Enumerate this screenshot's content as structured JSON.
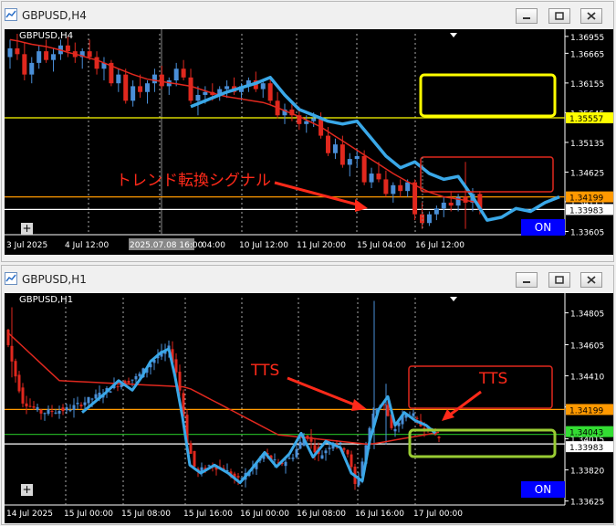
{
  "windows": [
    {
      "title": "GBPUSD,H4",
      "chart_label": "GBPUSD,H4",
      "on_label": "ON",
      "plus_label": "+",
      "annotation": "トレンド転換シグナル"
    },
    {
      "title": "GBPUSD,H1",
      "chart_label": "GBPUSD,H1",
      "on_label": "ON",
      "plus_label": "+",
      "annotation_left": "TTS",
      "annotation_right": "TTS"
    }
  ],
  "colors": {
    "bull": "#4a8fd8",
    "bear": "#e0281e",
    "ma": "#e0281e",
    "overlay": "#3aa8e8",
    "yellow": "#ffff00",
    "orange": "#ff9900",
    "green": "#22aa22",
    "white": "#ffffff",
    "lime_box": "#99cc33"
  },
  "chart_data": [
    {
      "type": "candlestick",
      "symbol": "GBPUSD",
      "timeframe": "H4",
      "x_tick_labels": [
        "3 Jul 2025",
        "4 Jul 12:00",
        "2025.07.08 16:00",
        "04:00",
        "10 Jul 12:00",
        "11 Jul 20:00",
        "15 Jul 04:00",
        "16 Jul 12:00"
      ],
      "y_tick_labels": [
        "1.36955",
        "1.36665",
        "1.36155",
        "1.35645",
        "1.35135",
        "1.34625",
        "1.34115",
        "1.33605"
      ],
      "ylim": [
        1.3355,
        1.37
      ],
      "price_labels": [
        {
          "value": "1.35557",
          "color": "yellow"
        },
        {
          "value": "1.34199",
          "color": "orange"
        },
        {
          "value": "1.33983",
          "color": "white"
        }
      ],
      "horizontal_lines": [
        {
          "value": 1.35557,
          "color": "yellow"
        },
        {
          "value": 1.34199,
          "color": "orange"
        },
        {
          "value": 1.33983,
          "color": "white"
        }
      ],
      "candles": [
        [
          1.366,
          1.369,
          1.364,
          1.3675
        ],
        [
          1.3675,
          1.37,
          1.3655,
          1.3665
        ],
        [
          1.3665,
          1.3685,
          1.362,
          1.363
        ],
        [
          1.363,
          1.366,
          1.3615,
          1.365
        ],
        [
          1.365,
          1.368,
          1.364,
          1.367
        ],
        [
          1.367,
          1.369,
          1.365,
          1.3655
        ],
        [
          1.3655,
          1.3675,
          1.3635,
          1.3665
        ],
        [
          1.3665,
          1.369,
          1.3655,
          1.368
        ],
        [
          1.368,
          1.3695,
          1.366,
          1.367
        ],
        [
          1.367,
          1.3685,
          1.365,
          1.366
        ],
        [
          1.366,
          1.3675,
          1.364,
          1.367
        ],
        [
          1.367,
          1.369,
          1.3655,
          1.366
        ],
        [
          1.366,
          1.367,
          1.363,
          1.364
        ],
        [
          1.364,
          1.366,
          1.362,
          1.365
        ],
        [
          1.365,
          1.3655,
          1.361,
          1.3615
        ],
        [
          1.3615,
          1.364,
          1.36,
          1.363
        ],
        [
          1.363,
          1.364,
          1.358,
          1.3585
        ],
        [
          1.3585,
          1.362,
          1.3575,
          1.361
        ],
        [
          1.361,
          1.363,
          1.359,
          1.36
        ],
        [
          1.36,
          1.362,
          1.358,
          1.3615
        ],
        [
          1.3615,
          1.364,
          1.36,
          1.363
        ],
        [
          1.363,
          1.3645,
          1.3605,
          1.361
        ],
        [
          1.361,
          1.3625,
          1.3595,
          1.362
        ],
        [
          1.362,
          1.365,
          1.361,
          1.364
        ],
        [
          1.364,
          1.3655,
          1.362,
          1.3625
        ],
        [
          1.3625,
          1.364,
          1.358,
          1.3585
        ],
        [
          1.3585,
          1.361,
          1.356,
          1.3595
        ],
        [
          1.3595,
          1.361,
          1.358,
          1.36
        ],
        [
          1.36,
          1.3615,
          1.3585,
          1.3595
        ],
        [
          1.3595,
          1.361,
          1.3585,
          1.3605
        ],
        [
          1.3605,
          1.362,
          1.359,
          1.361
        ],
        [
          1.361,
          1.3625,
          1.3595,
          1.36
        ],
        [
          1.36,
          1.3615,
          1.3585,
          1.361
        ],
        [
          1.361,
          1.3625,
          1.36,
          1.362
        ],
        [
          1.362,
          1.3635,
          1.36,
          1.3605
        ],
        [
          1.3605,
          1.362,
          1.359,
          1.3615
        ],
        [
          1.3615,
          1.3625,
          1.358,
          1.3585
        ],
        [
          1.3585,
          1.36,
          1.3555,
          1.356
        ],
        [
          1.356,
          1.358,
          1.3545,
          1.357
        ],
        [
          1.357,
          1.3585,
          1.355,
          1.356
        ],
        [
          1.356,
          1.3575,
          1.3535,
          1.3545
        ],
        [
          1.3545,
          1.356,
          1.353,
          1.355
        ],
        [
          1.355,
          1.3565,
          1.354,
          1.3555
        ],
        [
          1.3555,
          1.3565,
          1.352,
          1.3525
        ],
        [
          1.3525,
          1.354,
          1.349,
          1.3495
        ],
        [
          1.3495,
          1.352,
          1.3485,
          1.351
        ],
        [
          1.351,
          1.3525,
          1.347,
          1.3475
        ],
        [
          1.3475,
          1.3495,
          1.3455,
          1.3485
        ],
        [
          1.3485,
          1.35,
          1.347,
          1.349
        ],
        [
          1.349,
          1.35,
          1.344,
          1.3445
        ],
        [
          1.3445,
          1.347,
          1.3435,
          1.346
        ],
        [
          1.346,
          1.348,
          1.3445,
          1.345
        ],
        [
          1.345,
          1.3465,
          1.342,
          1.3425
        ],
        [
          1.3425,
          1.3445,
          1.341,
          1.344
        ],
        [
          1.344,
          1.345,
          1.342,
          1.343
        ],
        [
          1.343,
          1.345,
          1.342,
          1.3445
        ],
        [
          1.3445,
          1.345,
          1.338,
          1.339
        ],
        [
          1.339,
          1.341,
          1.3365,
          1.3375
        ],
        [
          1.3375,
          1.3395,
          1.337,
          1.339
        ],
        [
          1.339,
          1.3405,
          1.338,
          1.34
        ],
        [
          1.34,
          1.342,
          1.3385,
          1.341
        ],
        [
          1.341,
          1.343,
          1.3395,
          1.3405
        ],
        [
          1.3405,
          1.3425,
          1.3395,
          1.342
        ],
        [
          1.342,
          1.348,
          1.3365,
          1.341
        ],
        [
          1.341,
          1.3435,
          1.3395,
          1.3425
        ],
        [
          1.3425,
          1.343,
          1.339,
          1.3398
        ]
      ],
      "ma": [
        1.369,
        1.3688,
        1.3685,
        1.3682,
        1.368,
        1.3678,
        1.3675,
        1.3672,
        1.3668,
        1.3665,
        1.3662,
        1.3658,
        1.3655,
        1.365,
        1.3645,
        1.364,
        1.3635,
        1.363,
        1.3626,
        1.3622,
        1.362,
        1.3618,
        1.3616,
        1.3614,
        1.3612,
        1.361,
        1.3606,
        1.3602,
        1.3598,
        1.3595,
        1.3592,
        1.359,
        1.3588,
        1.3586,
        1.3584,
        1.3582,
        1.3578,
        1.3573,
        1.3568,
        1.3563,
        1.3558,
        1.3552,
        1.3546,
        1.354,
        1.3532,
        1.3524,
        1.3516,
        1.3508,
        1.35,
        1.3492,
        1.3484,
        1.3476,
        1.3468,
        1.346,
        1.3453,
        1.3446,
        1.344,
        1.3434,
        1.3428,
        1.3424,
        1.342,
        1.3418,
        1.3416,
        1.3414,
        1.3412,
        1.341
      ],
      "overlay": [
        [
          25,
          1.3575
        ],
        [
          30,
          1.36
        ],
        [
          34,
          1.3615
        ],
        [
          36,
          1.3625
        ],
        [
          38,
          1.3595
        ],
        [
          40,
          1.357
        ],
        [
          42,
          1.356
        ],
        [
          44,
          1.355
        ],
        [
          46,
          1.3545
        ],
        [
          48,
          1.355
        ],
        [
          50,
          1.352
        ],
        [
          52,
          1.349
        ],
        [
          54,
          1.347
        ],
        [
          56,
          1.348
        ],
        [
          58,
          1.346
        ],
        [
          60,
          1.345
        ],
        [
          62,
          1.3455
        ],
        [
          64,
          1.342
        ],
        [
          66,
          1.338
        ],
        [
          68,
          1.3385
        ],
        [
          70,
          1.34
        ],
        [
          72,
          1.3395
        ],
        [
          74,
          1.341
        ],
        [
          76,
          1.342
        ]
      ],
      "x_index_count": 77
    },
    {
      "type": "candlestick",
      "symbol": "GBPUSD",
      "timeframe": "H1",
      "x_tick_labels": [
        "14 Jul 2025",
        "15 Jul 00:00",
        "15 Jul 08:00",
        "15 Jul 16:00",
        "16 Jul 00:00",
        "16 Jul 08:00",
        "16 Jul 16:00",
        "17 Jul 00:00"
      ],
      "y_tick_labels": [
        "1.34805",
        "1.34605",
        "1.34410",
        "1.34215",
        "1.34015",
        "1.33820",
        "1.33625"
      ],
      "ylim": [
        1.336,
        1.349
      ],
      "price_labels": [
        {
          "value": "1.34199",
          "color": "orange"
        },
        {
          "value": "1.34043",
          "color": "green"
        },
        {
          "value": "1.33983",
          "color": "white"
        }
      ],
      "horizontal_lines": [
        {
          "value": 1.34199,
          "color": "orange"
        },
        {
          "value": 1.34043,
          "color": "green"
        },
        {
          "value": 1.33983,
          "color": "white"
        }
      ]
    }
  ]
}
